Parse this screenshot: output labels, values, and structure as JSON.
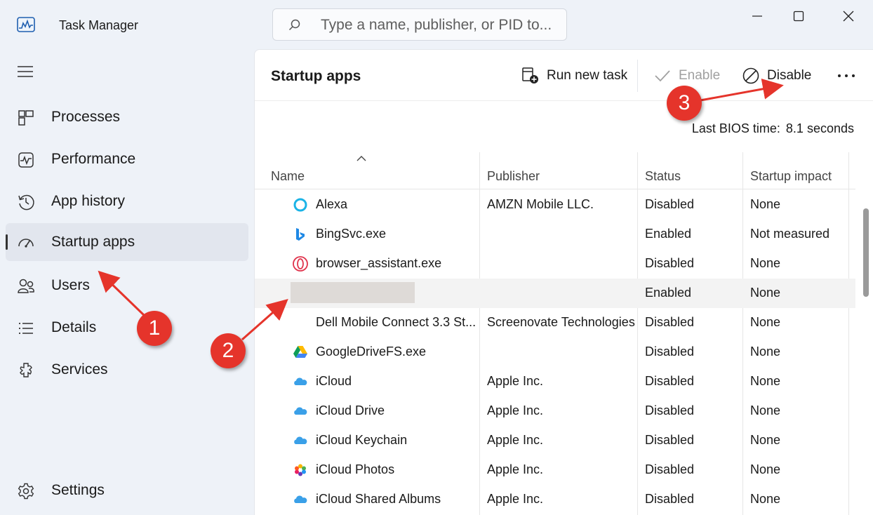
{
  "window": {
    "title": "Task Manager",
    "search_placeholder": "Type a name, publisher, or PID to..."
  },
  "sidebar": {
    "items": [
      {
        "label": "Processes",
        "icon": "processes-icon"
      },
      {
        "label": "Performance",
        "icon": "performance-icon"
      },
      {
        "label": "App history",
        "icon": "app-history-icon"
      },
      {
        "label": "Startup apps",
        "icon": "startup-apps-icon",
        "active": true
      },
      {
        "label": "Users",
        "icon": "users-icon"
      },
      {
        "label": "Details",
        "icon": "details-icon"
      },
      {
        "label": "Services",
        "icon": "services-icon"
      }
    ],
    "settings_label": "Settings"
  },
  "main": {
    "title": "Startup apps",
    "toolbar": {
      "run_new_task": "Run new task",
      "enable": "Enable",
      "disable": "Disable"
    },
    "bios_label": "Last BIOS time:",
    "bios_value": "8.1 seconds",
    "columns": [
      "Name",
      "Publisher",
      "Status",
      "Startup impact"
    ],
    "rows": [
      {
        "name": "Alexa",
        "publisher": "AMZN Mobile LLC.",
        "status": "Disabled",
        "impact": "None",
        "icon": "alexa-icon"
      },
      {
        "name": "BingSvc.exe",
        "publisher": "",
        "status": "Enabled",
        "impact": "Not measured",
        "icon": "bing-icon"
      },
      {
        "name": "browser_assistant.exe",
        "publisher": "",
        "status": "Disabled",
        "impact": "None",
        "icon": "opera-icon"
      },
      {
        "name": "",
        "publisher": "",
        "status": "Enabled",
        "impact": "None",
        "icon": "",
        "redacted": true
      },
      {
        "name": "Dell Mobile Connect 3.3 St...",
        "publisher": "Screenovate Technologies",
        "status": "Disabled",
        "impact": "None",
        "icon": ""
      },
      {
        "name": "GoogleDriveFS.exe",
        "publisher": "",
        "status": "Disabled",
        "impact": "None",
        "icon": "google-drive-icon"
      },
      {
        "name": "iCloud",
        "publisher": "Apple Inc.",
        "status": "Disabled",
        "impact": "None",
        "icon": "icloud-icon"
      },
      {
        "name": "iCloud Drive",
        "publisher": "Apple Inc.",
        "status": "Disabled",
        "impact": "None",
        "icon": "icloud-icon"
      },
      {
        "name": "iCloud Keychain",
        "publisher": "Apple Inc.",
        "status": "Disabled",
        "impact": "None",
        "icon": "icloud-icon"
      },
      {
        "name": "iCloud Photos",
        "publisher": "Apple Inc.",
        "status": "Disabled",
        "impact": "None",
        "icon": "photos-icon"
      },
      {
        "name": "iCloud Shared Albums",
        "publisher": "Apple Inc.",
        "status": "Disabled",
        "impact": "None",
        "icon": "icloud-icon"
      }
    ]
  },
  "annotations": {
    "badges": [
      "1",
      "2",
      "3"
    ],
    "color": "#e5342b"
  }
}
